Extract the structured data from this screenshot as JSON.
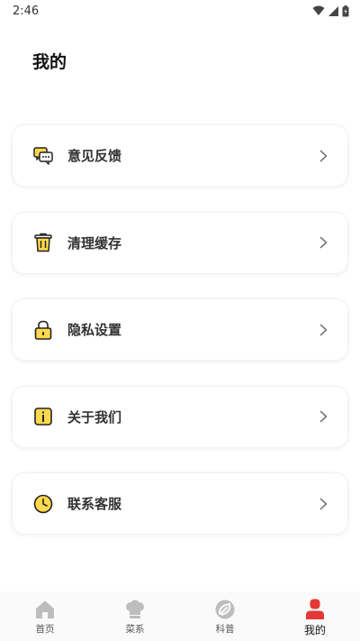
{
  "status_bar": {
    "time": "2:46"
  },
  "page": {
    "title": "我的"
  },
  "menu": [
    {
      "label": "意见反馈",
      "icon": "chat-bubbles-icon"
    },
    {
      "label": "清理缓存",
      "icon": "trash-icon"
    },
    {
      "label": "隐私设置",
      "icon": "lock-icon"
    },
    {
      "label": "关于我们",
      "icon": "info-icon"
    },
    {
      "label": "联系客服",
      "icon": "clock-icon"
    }
  ],
  "tabs": [
    {
      "label": "首页",
      "icon": "home-icon",
      "active": false
    },
    {
      "label": "菜系",
      "icon": "chef-hat-icon",
      "active": false
    },
    {
      "label": "科普",
      "icon": "science-icon",
      "active": false
    },
    {
      "label": "我的",
      "icon": "user-icon",
      "active": true
    }
  ],
  "colors": {
    "accent_yellow": "#FFD84D",
    "active_red": "#E53935",
    "inactive_gray": "#BDBDBD"
  }
}
